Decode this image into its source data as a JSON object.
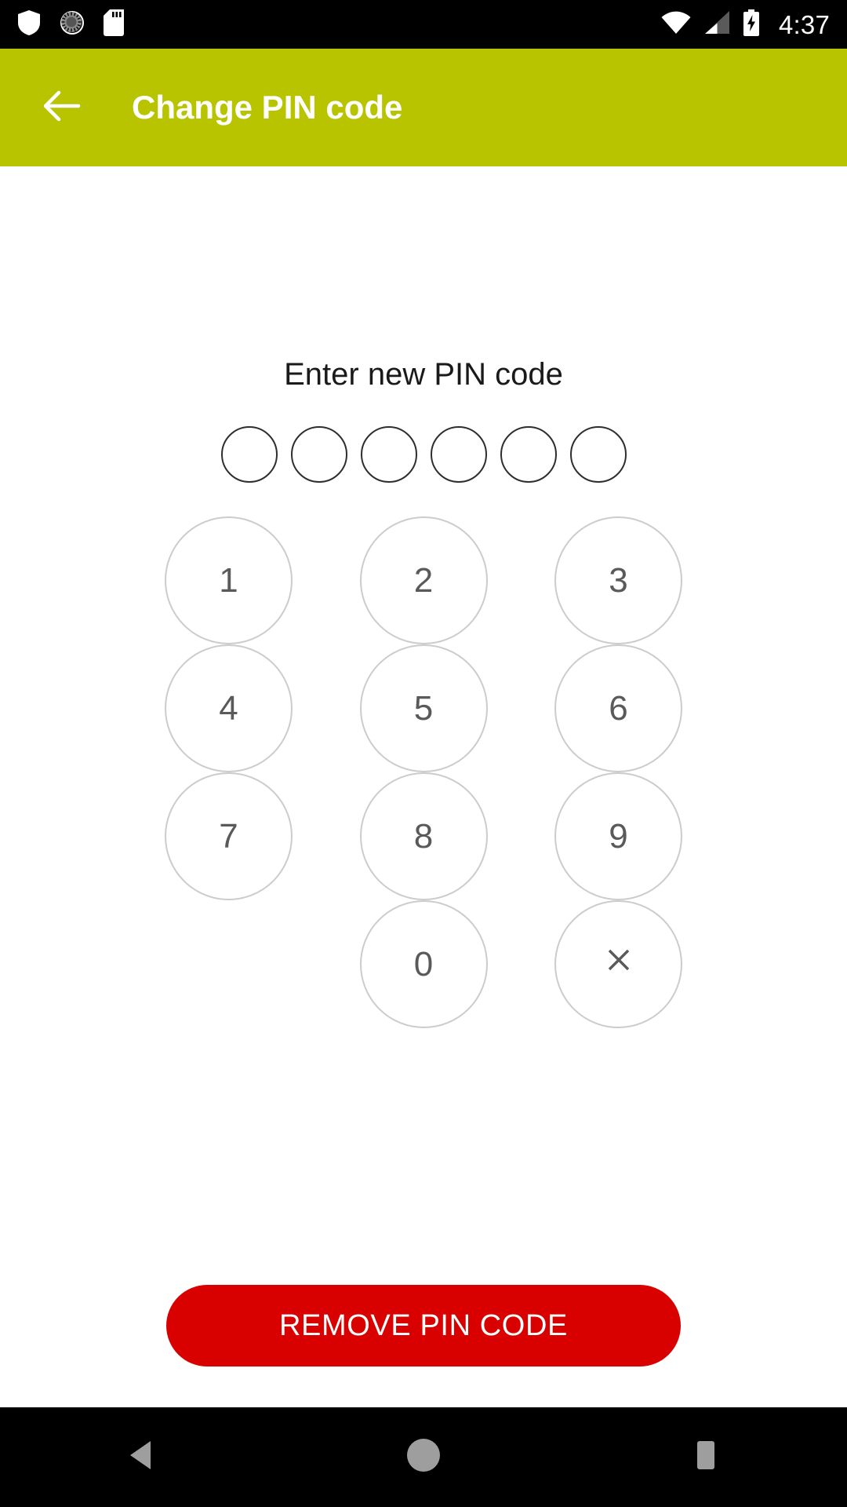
{
  "status_bar": {
    "left_icons": [
      {
        "name": "shield-icon",
        "label": "shield"
      },
      {
        "name": "sync-progress-icon",
        "label": "sync"
      },
      {
        "name": "sd-card-icon",
        "label": "sd card"
      }
    ],
    "right_icons": [
      {
        "name": "wifi-icon",
        "label": "wifi"
      },
      {
        "name": "cellular-signal-icon",
        "label": "signal"
      },
      {
        "name": "battery-charging-icon",
        "label": "battery charging"
      }
    ],
    "clock": "4:37"
  },
  "app_bar": {
    "back_label": "Back",
    "title": "Change PIN code",
    "background_color": "#b8c400",
    "text_color": "#ffffff"
  },
  "main": {
    "prompt": "Enter new PIN code",
    "pin": {
      "length": 6,
      "entered": 0,
      "dots": [
        "",
        "",
        "",
        "",
        "",
        ""
      ]
    },
    "keypad": {
      "rows": [
        [
          {
            "key": "1",
            "type": "digit"
          },
          {
            "key": "2",
            "type": "digit"
          },
          {
            "key": "3",
            "type": "digit"
          }
        ],
        [
          {
            "key": "4",
            "type": "digit"
          },
          {
            "key": "5",
            "type": "digit"
          },
          {
            "key": "6",
            "type": "digit"
          }
        ],
        [
          {
            "key": "7",
            "type": "digit"
          },
          {
            "key": "8",
            "type": "digit"
          },
          {
            "key": "9",
            "type": "digit"
          }
        ],
        [
          {
            "key": "",
            "type": "blank"
          },
          {
            "key": "0",
            "type": "digit"
          },
          {
            "key": "×",
            "type": "clear"
          }
        ]
      ]
    },
    "remove_button": {
      "label": "REMOVE PIN CODE",
      "background_color": "#d90000",
      "text_color": "#ffffff"
    }
  },
  "nav_bar": {
    "buttons": [
      {
        "name": "nav-back-button",
        "label": "Back"
      },
      {
        "name": "nav-home-button",
        "label": "Home"
      },
      {
        "name": "nav-recents-button",
        "label": "Recents"
      }
    ],
    "icon_color": "#9e9e9e"
  }
}
